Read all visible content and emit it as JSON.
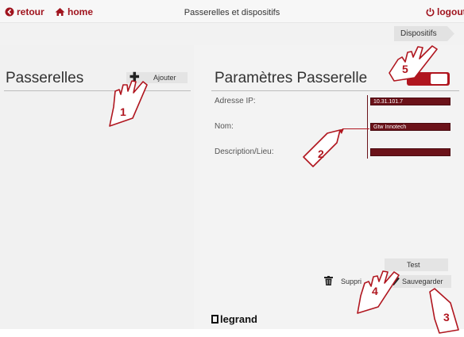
{
  "topbar": {
    "back_label": "retour",
    "home_label": "home",
    "title": "Passerelles et dispositifs",
    "logout_label": "logout"
  },
  "subbar": {
    "tab_label": "Dispositifs"
  },
  "left": {
    "title": "Passerelles",
    "add_label": "Ajouter"
  },
  "right": {
    "title": "Paramètres Passerelle",
    "ip_label": "Adresse IP:",
    "ip_value": "10.31.101.7",
    "name_label": "Nom:",
    "name_value": "Gtw Innotech",
    "desc_label": "Description/Lieu:",
    "desc_value": "",
    "test_label": "Test",
    "delete_label": "Supprimer",
    "save_label": "Sauvegarder"
  },
  "footer": {
    "brand": "legrand"
  },
  "callouts": {
    "c1": "1",
    "c2": "2",
    "c3": "3",
    "c4": "4",
    "c5": "5"
  },
  "colors": {
    "accent": "#a0141e",
    "field": "#6b1219"
  },
  "icons": [
    "back-circle-icon",
    "home-icon",
    "power-icon",
    "plus-icon",
    "trash-icon",
    "checkmark-icon",
    "toggle-icon",
    "pointer-hand-icon",
    "pencil-icon"
  ]
}
